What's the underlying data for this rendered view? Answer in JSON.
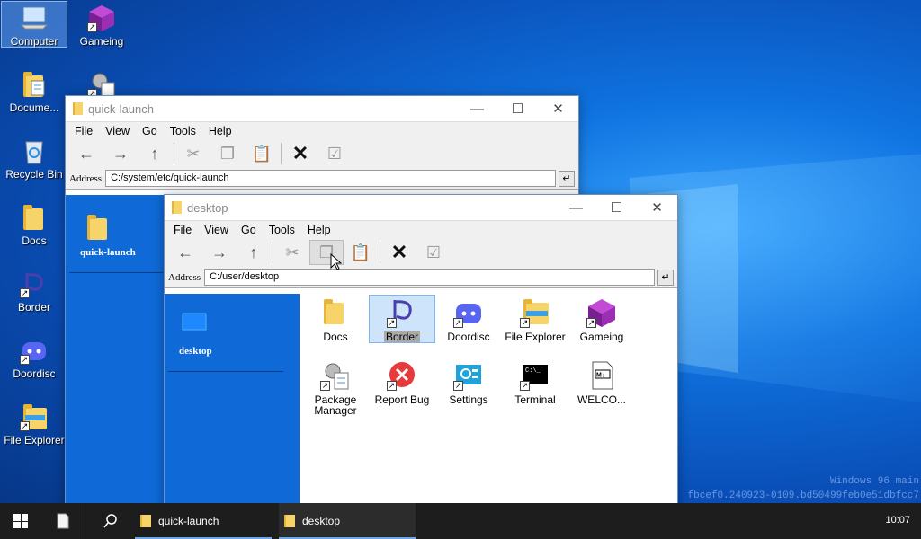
{
  "desktop": {
    "icons": [
      {
        "label": "Computer",
        "icon": "computer-icon"
      },
      {
        "label": "Gameing",
        "icon": "cube-icon"
      },
      {
        "label": "Docume...",
        "icon": "documents-icon"
      },
      {
        "label": "",
        "icon": "package-manager-icon"
      },
      {
        "label": "Recycle Bin",
        "icon": "recycle-bin-icon"
      },
      {
        "label": "Docs",
        "icon": "folder-icon"
      },
      {
        "label": "Border",
        "icon": "border-icon"
      },
      {
        "label": "Doordisc",
        "icon": "discord-icon"
      },
      {
        "label": "File Explorer",
        "icon": "file-explorer-icon"
      }
    ],
    "watermark_line1": "Windows 96 main",
    "watermark_line2": "fbcef0.240923-0109.bd50499feb0e51dbfcc7"
  },
  "menus": [
    "File",
    "View",
    "Go",
    "Tools",
    "Help"
  ],
  "address_label": "Address",
  "window_back": {
    "title": "quick-launch",
    "address": "C:/system/etc/quick-launch",
    "panel_caption": "quick-launch"
  },
  "window_front": {
    "title": "desktop",
    "address": "C:/user/desktop",
    "panel_caption": "desktop",
    "files": [
      {
        "label": "Docs",
        "icon": "folder-icon"
      },
      {
        "label": "Border",
        "icon": "border-icon"
      },
      {
        "label": "Doordisc",
        "icon": "discord-icon"
      },
      {
        "label": "File Explorer",
        "icon": "file-explorer-icon"
      },
      {
        "label": "Gameing",
        "icon": "cube-icon"
      },
      {
        "label": "Package Manager",
        "icon": "package-manager-icon"
      },
      {
        "label": "Report Bug",
        "icon": "report-bug-icon"
      },
      {
        "label": "Settings",
        "icon": "settings-icon"
      },
      {
        "label": "Terminal",
        "icon": "terminal-icon"
      },
      {
        "label": "WELCO...",
        "icon": "markdown-file-icon"
      }
    ]
  },
  "taskbar": {
    "items": [
      "quick-launch",
      "desktop"
    ],
    "clock": "10:07"
  }
}
